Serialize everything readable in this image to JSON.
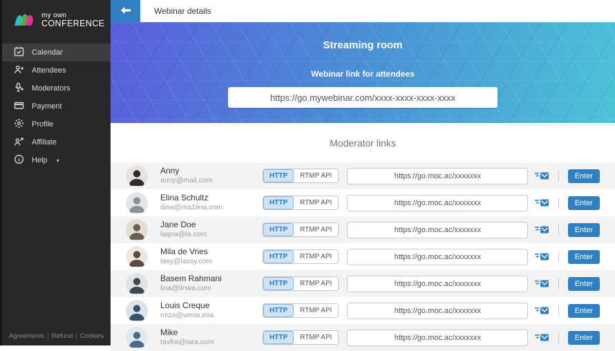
{
  "sidebar": {
    "logo": {
      "line1": "my own",
      "line2": "CONFERENCE"
    },
    "items": [
      {
        "label": "Calendar",
        "icon": "calendar-icon",
        "active": true
      },
      {
        "label": "Attendees",
        "icon": "attendees-icon",
        "active": false
      },
      {
        "label": "Moderators",
        "icon": "moderators-icon",
        "active": false
      },
      {
        "label": "Payment",
        "icon": "payment-icon",
        "active": false
      },
      {
        "label": "Profile",
        "icon": "gear-icon",
        "active": false
      },
      {
        "label": "Affiliate",
        "icon": "affiliate-icon",
        "active": false
      },
      {
        "label": "Help",
        "icon": "help-icon",
        "active": false,
        "caret": "▾"
      }
    ],
    "footer_links": [
      "Agreements",
      "Refund",
      "Cookies"
    ]
  },
  "header": {
    "title": "Webinar details"
  },
  "banner": {
    "title": "Streaming room",
    "subtitle": "Webinar link for attendees",
    "link_value": "https://go.mywebinar.com/xxxx-xxxx-xxxx-xxxx",
    "gradient_start": "#5a5edb",
    "gradient_end": "#4cc3d7"
  },
  "moderators": {
    "heading": "Moderator links",
    "toggle": {
      "http_label": "HTTP",
      "rtmp_label": "RTMP API"
    },
    "enter_label": "Enter",
    "rows": [
      {
        "name": "Anny",
        "email": "anny@mail.com",
        "link": "https://go.moc.ac/xxxxxxx",
        "avatar": {
          "bg": "#e8e2dc",
          "fg": "#2f2b33"
        }
      },
      {
        "name": "Elina Schultz",
        "email": "dina@ma1lina.com",
        "link": "https://go.moc.ac/xxxxxxx",
        "avatar": {
          "bg": "#dfe7ea",
          "fg": "#8a9298"
        }
      },
      {
        "name": "Jane Doe",
        "email": "laqna@la.com",
        "link": "https://go.moc.ac/xxxxxxx",
        "avatar": {
          "bg": "#e3ddd6",
          "fg": "#6b5d52"
        }
      },
      {
        "name": "Mila de Vries",
        "email": "lasy@lassy.com",
        "link": "https://go.moc.ac/xxxxxxx",
        "avatar": {
          "bg": "#efe7e2",
          "fg": "#5d4a42"
        }
      },
      {
        "name": "Basem Rahmani",
        "email": "lina@linwa.com",
        "link": "https://go.moc.ac/xxxxxxx",
        "avatar": {
          "bg": "#dfe3e6",
          "fg": "#3f4750"
        }
      },
      {
        "name": "Louis Creque",
        "email": "miza@wmia.mia",
        "link": "https://go.moc.ac/xxxxxxx",
        "avatar": {
          "bg": "#dce4ea",
          "fg": "#37536b"
        }
      },
      {
        "name": "Mike",
        "email": "tavfra@tara.com",
        "link": "https://go.moc.ac/xxxxxxx",
        "avatar": {
          "bg": "#dfe9f0",
          "fg": "#4a6b8a"
        }
      }
    ]
  },
  "colors": {
    "accent": "#2e80c2",
    "sidebar_bg": "#282828",
    "row_alt_bg": "#f3f3f3",
    "toggle_active_bg": "#cfe4f7"
  }
}
